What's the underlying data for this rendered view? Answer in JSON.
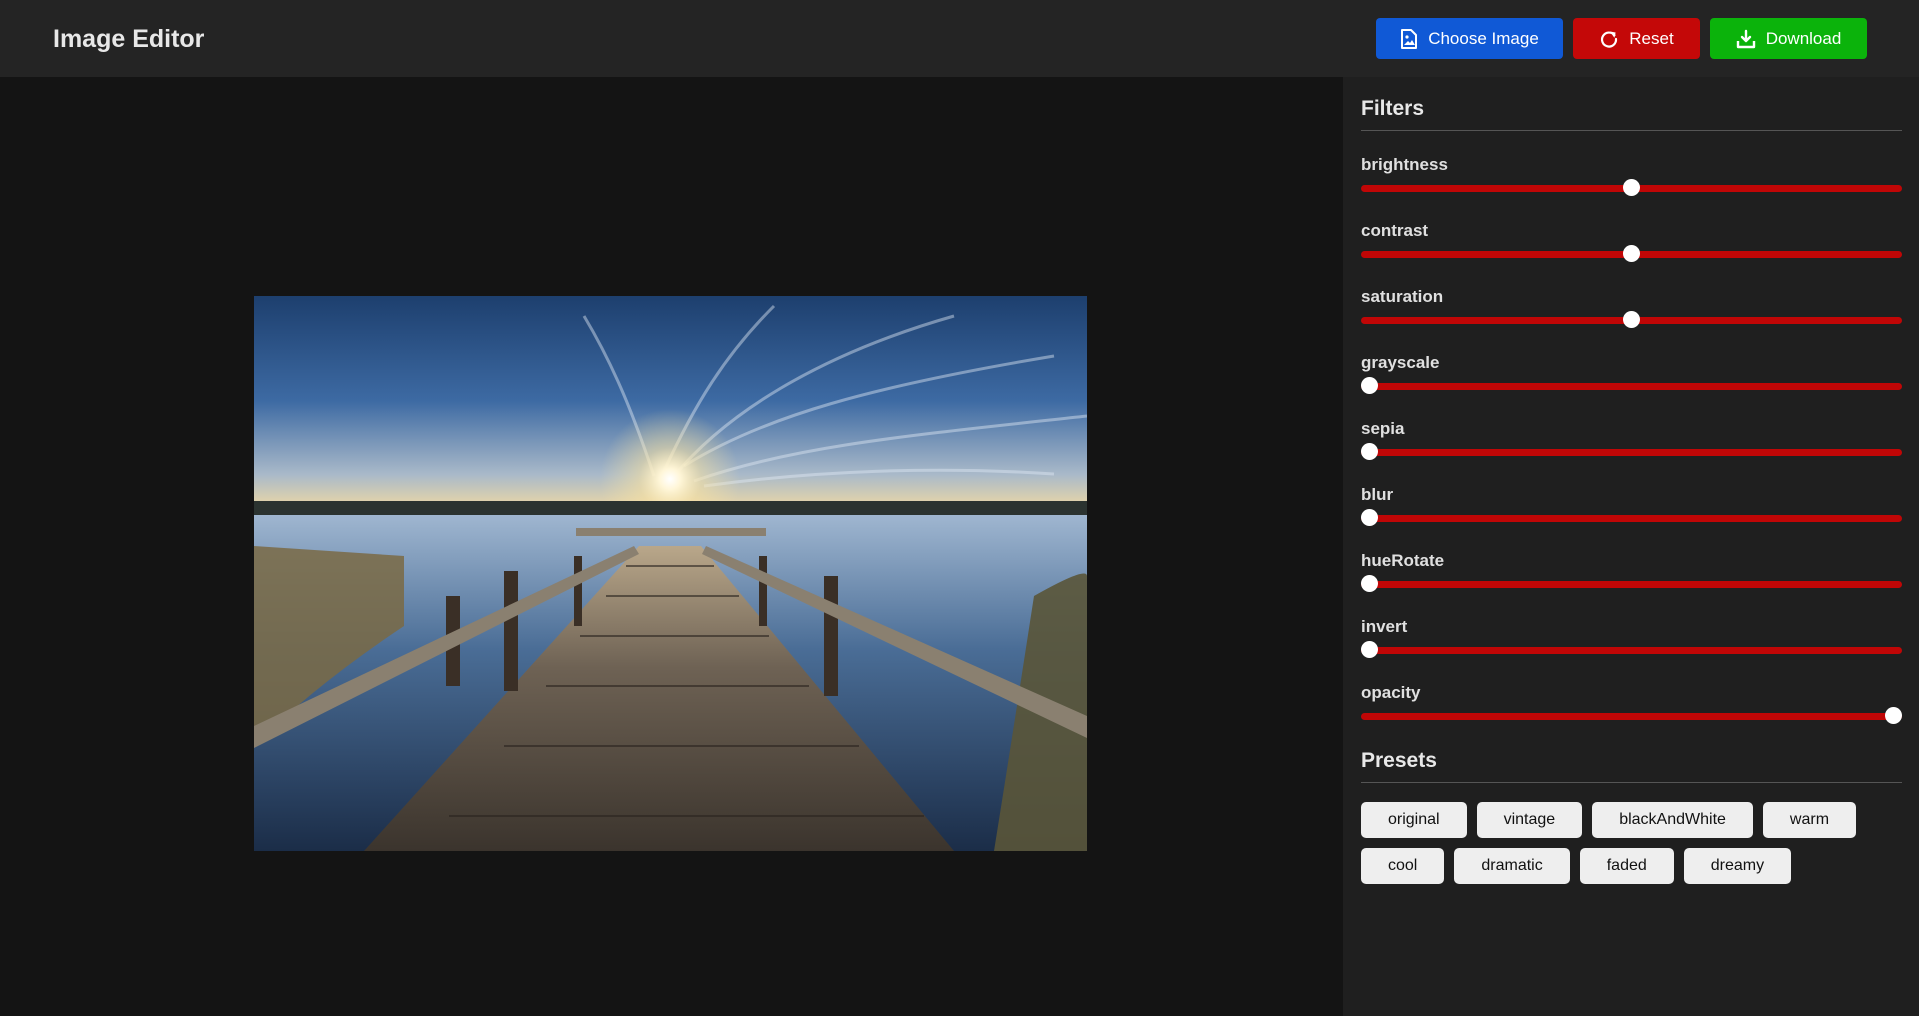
{
  "header": {
    "title": "Image Editor",
    "choose_label": "Choose Image",
    "reset_label": "Reset",
    "download_label": "Download"
  },
  "colors": {
    "header_bg": "#242424",
    "canvas_bg": "#141414",
    "sidebar_bg": "#1f1f1f",
    "choose": "#1059d6",
    "reset": "#c40808",
    "download": "#0bb30b",
    "slider_track": "#c00606"
  },
  "icons": {
    "choose": "image-file-icon",
    "reset": "refresh-icon",
    "download": "download-icon"
  },
  "filters": {
    "title": "Filters",
    "items": [
      {
        "label": "brightness",
        "value": 0.5
      },
      {
        "label": "contrast",
        "value": 0.5
      },
      {
        "label": "saturation",
        "value": 0.5
      },
      {
        "label": "grayscale",
        "value": 0
      },
      {
        "label": "sepia",
        "value": 0
      },
      {
        "label": "blur",
        "value": 0
      },
      {
        "label": "hueRotate",
        "value": 0
      },
      {
        "label": "invert",
        "value": 0
      },
      {
        "label": "opacity",
        "value": 1
      }
    ]
  },
  "presets": {
    "title": "Presets",
    "items": [
      "original",
      "vintage",
      "blackAndWhite",
      "warm",
      "cool",
      "dramatic",
      "faded",
      "dreamy"
    ]
  }
}
